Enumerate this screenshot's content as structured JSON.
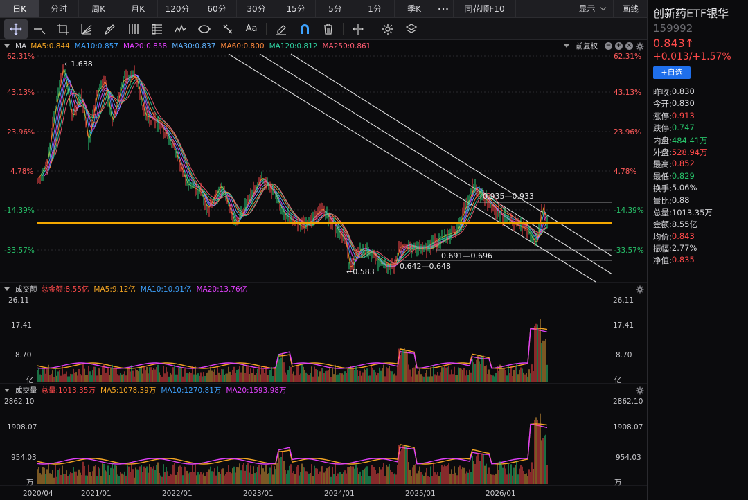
{
  "tabs": [
    {
      "label": "日K",
      "active": true
    },
    {
      "label": "分时"
    },
    {
      "label": "周K"
    },
    {
      "label": "月K"
    },
    {
      "label": "120分"
    },
    {
      "label": "60分"
    },
    {
      "label": "30分"
    },
    {
      "label": "15分"
    },
    {
      "label": "5分"
    },
    {
      "label": "1分"
    },
    {
      "label": "季K"
    }
  ],
  "more_label": "···",
  "f10_label": "同花顺F10",
  "show_label": "显示",
  "draw_label": "画线",
  "toolbar_icons": [
    "crosshair-icon",
    "horizontal-line-icon",
    "crop-icon",
    "fan-icon",
    "pen-icon",
    "parallel-lines-icon",
    "list-icon",
    "wave-icon",
    "ellipse-icon",
    "measure-icon",
    "text-icon",
    "eraser-icon",
    "magnet-icon",
    "trash-icon",
    "flip-icon",
    "settings-icon",
    "layers-icon"
  ],
  "text_tool_label": "Aa",
  "price_panel": {
    "name": "MA",
    "ma": [
      {
        "label": "MA5:0.844",
        "color": "#f5a623"
      },
      {
        "label": "MA10:0.857",
        "color": "#3ea3ff"
      },
      {
        "label": "MA20:0.858",
        "color": "#e040fb"
      },
      {
        "label": "MA30:0.837",
        "color": "#5fb3ff"
      },
      {
        "label": "MA60:0.800",
        "color": "#ff8a3d"
      },
      {
        "label": "MA120:0.812",
        "color": "#2fd0a0"
      },
      {
        "label": "MA250:0.861",
        "color": "#ff5d73"
      }
    ],
    "fq_label": "前复权",
    "y_ticks": [
      "62.31%",
      "43.13%",
      "23.96%",
      "4.78%",
      "-14.39%",
      "-33.57%"
    ],
    "annotations": {
      "high": "←1.638",
      "low": "←0.583",
      "range1": "0.642—0.648",
      "range2": "0.691—0.696",
      "range3": "0.935—0.933"
    }
  },
  "amount_panel": {
    "name": "成交额",
    "items": [
      {
        "label": "总金额:8.55亿",
        "color": "#ff4a4a"
      },
      {
        "label": "MA5:9.12亿",
        "color": "#f5a623"
      },
      {
        "label": "MA10:10.91亿",
        "color": "#3ea3ff"
      },
      {
        "label": "MA20:13.76亿",
        "color": "#e040fb"
      }
    ],
    "y_ticks": [
      "26.11",
      "17.41",
      "8.70",
      "亿"
    ]
  },
  "volume_panel": {
    "name": "成交量",
    "items": [
      {
        "label": "总量:1013.35万",
        "color": "#ff4a4a"
      },
      {
        "label": "MA5:1078.39万",
        "color": "#f5a623"
      },
      {
        "label": "MA10:1270.81万",
        "color": "#3ea3ff"
      },
      {
        "label": "MA20:1593.98万",
        "color": "#e040fb"
      }
    ],
    "y_ticks": [
      "2862.10",
      "1908.07",
      "954.03",
      "万"
    ]
  },
  "x_labels": [
    "2020/04",
    "2021/01",
    "2022/01",
    "2023/01",
    "2024/01",
    "2025/01",
    "2026/01"
  ],
  "stock": {
    "name": "创新药ETF银华",
    "code": "159992",
    "price": "0.843↑",
    "change": "+0.013/+1.57%",
    "add_label": "+自选"
  },
  "stats": [
    {
      "k": "昨收:",
      "v": "0.830",
      "c": "white"
    },
    {
      "k": "今开:",
      "v": "0.830",
      "c": "white"
    },
    {
      "k": "涨停:",
      "v": "0.913",
      "c": "red"
    },
    {
      "k": "跌停:",
      "v": "0.747",
      "c": "green"
    },
    {
      "k": "内盘:",
      "v": "484.41万",
      "c": "green"
    },
    {
      "k": "外盘:",
      "v": "528.94万",
      "c": "red"
    },
    {
      "k": "最高:",
      "v": "0.852",
      "c": "red"
    },
    {
      "k": "最低:",
      "v": "0.829",
      "c": "green"
    },
    {
      "k": "换手:",
      "v": "5.06%",
      "c": "white"
    },
    {
      "k": "量比:",
      "v": "0.88",
      "c": "white"
    },
    {
      "k": "总量:",
      "v": "1013.35万",
      "c": "white"
    },
    {
      "k": "金额:",
      "v": "8.55亿",
      "c": "white"
    },
    {
      "k": "均价:",
      "v": "0.843",
      "c": "red"
    },
    {
      "k": "振幅:",
      "v": "2.77%",
      "c": "white"
    },
    {
      "k": "净值:",
      "v": "0.835",
      "c": "red"
    }
  ]
}
